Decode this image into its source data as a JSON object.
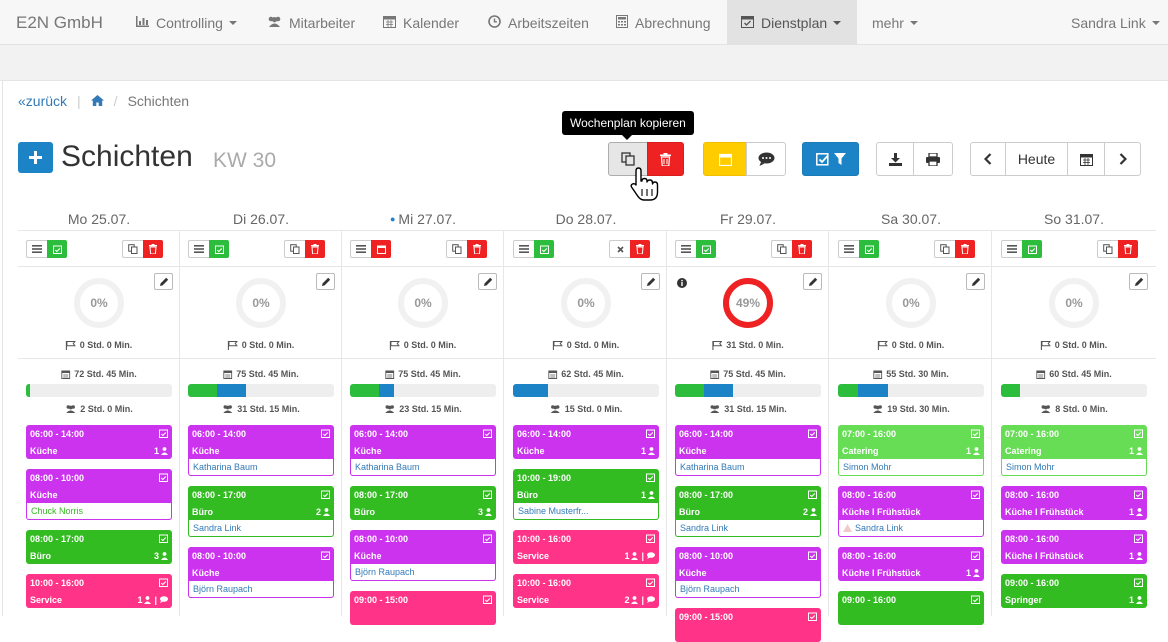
{
  "navbar": {
    "brand": "E2N GmbH",
    "items": [
      {
        "label": "Controlling",
        "icon": "bar-chart-icon",
        "caret": true
      },
      {
        "label": "Mitarbeiter",
        "icon": "users-icon"
      },
      {
        "label": "Kalender",
        "icon": "calendar-icon"
      },
      {
        "label": "Arbeitszeiten",
        "icon": "clock-icon"
      },
      {
        "label": "Abrechnung",
        "icon": "calculator-icon"
      },
      {
        "label": "Dienstplan",
        "icon": "calendar-check-icon",
        "caret": true,
        "active": true
      },
      {
        "label": "mehr",
        "caret": true
      }
    ],
    "user": "Sandra Link"
  },
  "breadcrumb": {
    "back": "zurück",
    "current": "Schichten"
  },
  "header": {
    "title": "Schichten",
    "week": "KW 30",
    "tooltip": "Wochenplan kopieren",
    "today_label": "Heute"
  },
  "colors": {
    "purple": "#cc33ee",
    "green": "#33bb22",
    "lightgreen": "#66dd55",
    "pink": "#ff3388",
    "red": "#ee2222",
    "yellow": "#ffcc00",
    "blue": "#1c84c6"
  },
  "days": [
    {
      "label": "Mo 25.07.",
      "today": false,
      "percent": "0%",
      "flag": "0 Std. 0 Min.",
      "planned": "72 Std. 45 Min.",
      "assigned": "2 Std. 0 Min.",
      "shifts": [
        {
          "time": "06:00 - 14:00",
          "role": "Küche",
          "count": "1",
          "color": "purple"
        },
        {
          "time": "08:00 - 10:00",
          "role": "Küche",
          "employee": "Chuck Norris",
          "color": "purple",
          "empcolor": "green"
        },
        {
          "time": "08:00 - 17:00",
          "role": "Büro",
          "count": "3",
          "color": "green"
        },
        {
          "time": "10:00 - 16:00",
          "role": "Service",
          "count": "1",
          "chat": true,
          "color": "pink"
        }
      ]
    },
    {
      "label": "Di 26.07.",
      "today": false,
      "percent": "0%",
      "flag": "0 Std. 0 Min.",
      "planned": "75 Std. 45 Min.",
      "assigned": "31 Std. 15 Min.",
      "shifts": [
        {
          "time": "06:00 - 14:00",
          "role": "Küche",
          "employee": "Katharina Baum",
          "color": "purple"
        },
        {
          "time": "08:00 - 17:00",
          "role": "Büro",
          "count": "2",
          "employee": "Sandra Link",
          "color": "green"
        },
        {
          "time": "08:00 - 10:00",
          "role": "Küche",
          "employee": "Björn Raupach",
          "color": "purple"
        }
      ]
    },
    {
      "label": "Mi 27.07.",
      "today": true,
      "percent": "0%",
      "flag": "0 Std. 0 Min.",
      "planned": "75 Std. 45 Min.",
      "assigned": "23 Std. 15 Min.",
      "shifts": [
        {
          "time": "06:00 - 14:00",
          "role": "Küche",
          "employee": "Katharina Baum",
          "color": "purple"
        },
        {
          "time": "08:00 - 17:00",
          "role": "Büro",
          "count": "3",
          "color": "green"
        },
        {
          "time": "08:00 - 10:00",
          "role": "Küche",
          "employee": "Björn Raupach",
          "color": "purple"
        },
        {
          "time": "09:00 - 15:00",
          "role": "",
          "color": "pink"
        }
      ]
    },
    {
      "label": "Do 28.07.",
      "today": false,
      "percent": "0%",
      "flag": "0 Std. 0 Min.",
      "planned": "62 Std. 45 Min.",
      "assigned": "15 Std. 0 Min.",
      "shifts": [
        {
          "time": "06:00 - 14:00",
          "role": "Küche",
          "count": "1",
          "color": "purple"
        },
        {
          "time": "10:00 - 19:00",
          "role": "Büro",
          "count": "1",
          "employee": "Sabine Musterfr...",
          "color": "green"
        },
        {
          "time": "10:00 - 16:00",
          "role": "Service",
          "count": "1",
          "chat": true,
          "color": "pink"
        },
        {
          "time": "10:00 - 16:00",
          "role": "Service",
          "count": "2",
          "chat": true,
          "color": "pink"
        }
      ]
    },
    {
      "label": "Fr 29.07.",
      "today": false,
      "percent": "49%",
      "flag": "31 Std. 0 Min.",
      "planned": "75 Std. 45 Min.",
      "assigned": "31 Std. 15 Min.",
      "shifts": [
        {
          "time": "06:00 - 14:00",
          "role": "Küche",
          "employee": "Katharina Baum",
          "color": "purple"
        },
        {
          "time": "08:00 - 17:00",
          "role": "Büro",
          "count": "2",
          "employee": "Sandra Link",
          "color": "green"
        },
        {
          "time": "08:00 - 10:00",
          "role": "Küche",
          "employee": "Björn Raupach",
          "color": "purple"
        },
        {
          "time": "09:00 - 15:00",
          "role": "",
          "color": "pink"
        }
      ]
    },
    {
      "label": "Sa 30.07.",
      "today": false,
      "percent": "0%",
      "flag": "0 Std. 0 Min.",
      "planned": "55 Std. 30 Min.",
      "assigned": "19 Std. 30 Min.",
      "shifts": [
        {
          "time": "07:00 - 16:00",
          "role": "Catering",
          "count": "1",
          "employee": "Simon Mohr",
          "color": "lightgreen"
        },
        {
          "time": "08:00 - 16:00",
          "role": "Küche I Frühstück",
          "employee": "Sandra Link",
          "warn": true,
          "color": "purple"
        },
        {
          "time": "08:00 - 16:00",
          "role": "Küche I Frühstück",
          "count": "1",
          "color": "purple"
        },
        {
          "time": "09:00 - 16:00",
          "role": "",
          "color": "green"
        }
      ]
    },
    {
      "label": "So 31.07.",
      "today": false,
      "percent": "0%",
      "flag": "0 Std. 0 Min.",
      "planned": "60 Std. 45 Min.",
      "assigned": "8 Std. 0 Min.",
      "shifts": [
        {
          "time": "07:00 - 16:00",
          "role": "Catering",
          "count": "1",
          "employee": "Simon Mohr",
          "color": "lightgreen"
        },
        {
          "time": "08:00 - 16:00",
          "role": "Küche I Frühstück",
          "count": "1",
          "color": "purple"
        },
        {
          "time": "08:00 - 16:00",
          "role": "Küche I Frühstück",
          "count": "1",
          "color": "purple"
        },
        {
          "time": "09:00 - 16:00",
          "role": "Springer",
          "count": "1",
          "color": "green"
        }
      ]
    }
  ],
  "progress": [
    {
      "green": 0.03,
      "blue": 0
    },
    {
      "green": 0.2,
      "blue": 0.2
    },
    {
      "green": 0.2,
      "blue": 0.1
    },
    {
      "green": 0,
      "blue": 0.24
    },
    {
      "green": 0.2,
      "blue": 0.2
    },
    {
      "green": 0.14,
      "blue": 0.2
    },
    {
      "green": 0.13,
      "blue": 0
    }
  ],
  "ring_fill": [
    0,
    0,
    0,
    0,
    0,
    0.49,
    0,
    0
  ]
}
